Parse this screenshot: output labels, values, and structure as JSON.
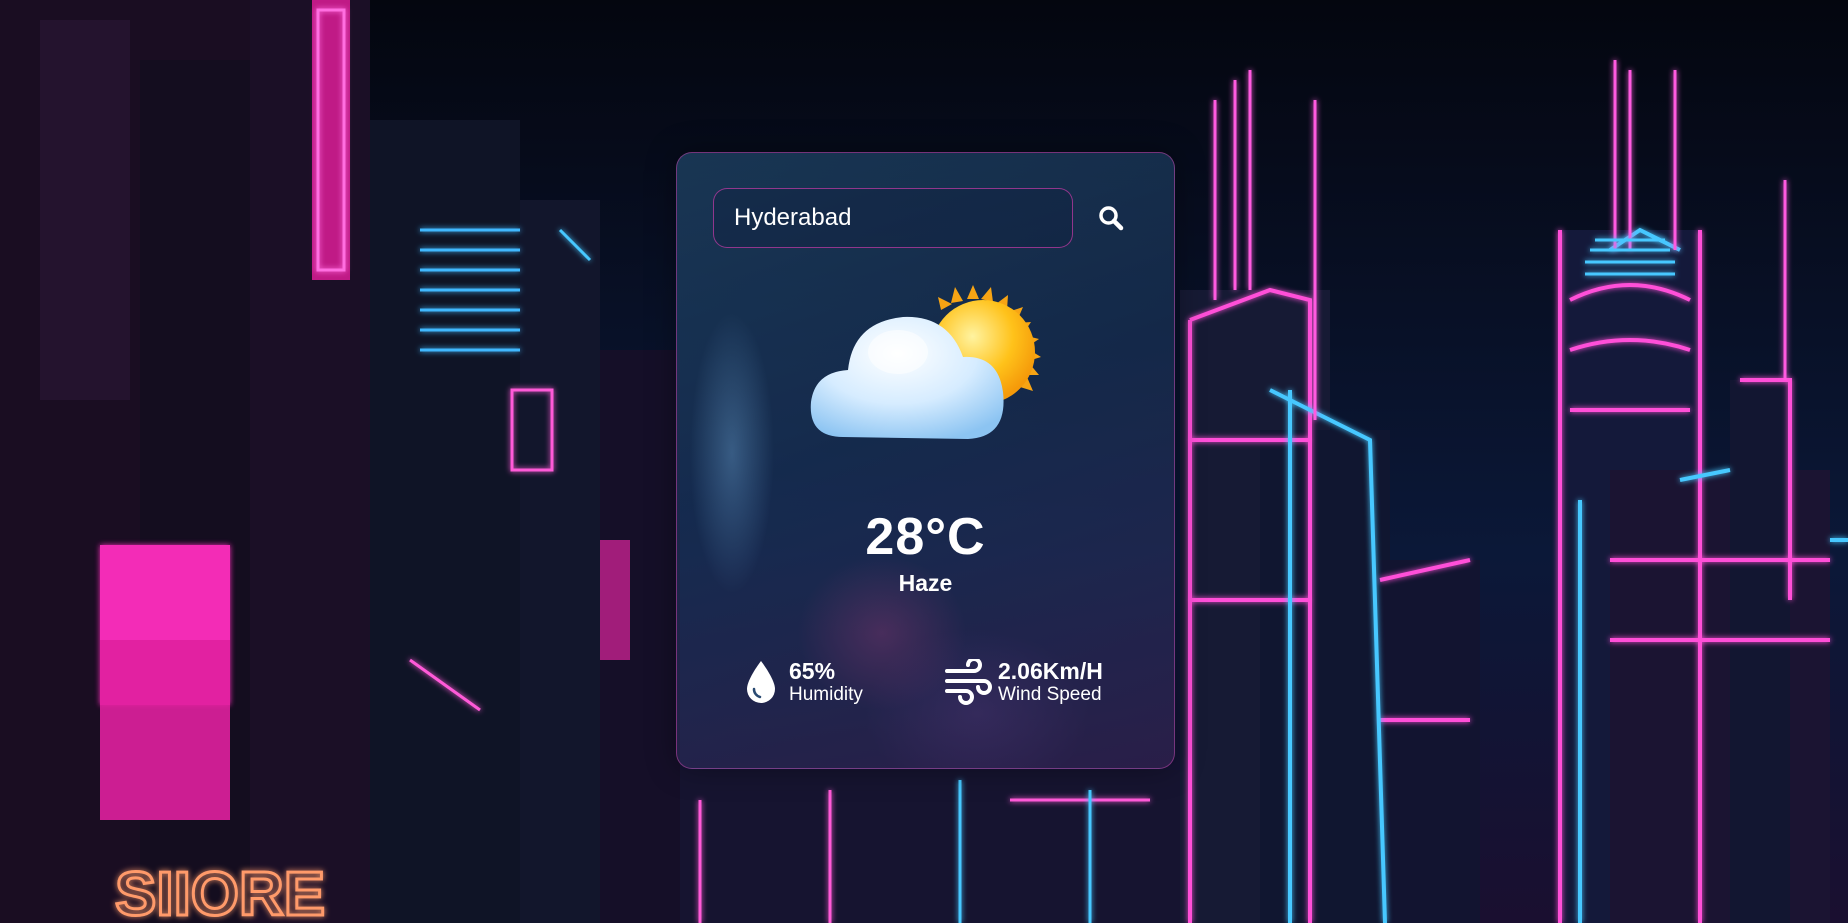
{
  "search": {
    "value": "Hyderabad"
  },
  "weather": {
    "temperature": "28°C",
    "condition": "Haze",
    "icon": "partly-cloudy-icon"
  },
  "details": {
    "humidity": {
      "value": "65%",
      "label": "Humidity",
      "icon": "water-drop-icon"
    },
    "wind": {
      "value": "2.06Km/H",
      "label": "Wind Speed",
      "icon": "wind-icon"
    }
  },
  "colors": {
    "accent_border": "#be46aa",
    "text": "#ffffff",
    "neon_pink": "#ff3cc8",
    "neon_blue": "#46c8ff"
  }
}
